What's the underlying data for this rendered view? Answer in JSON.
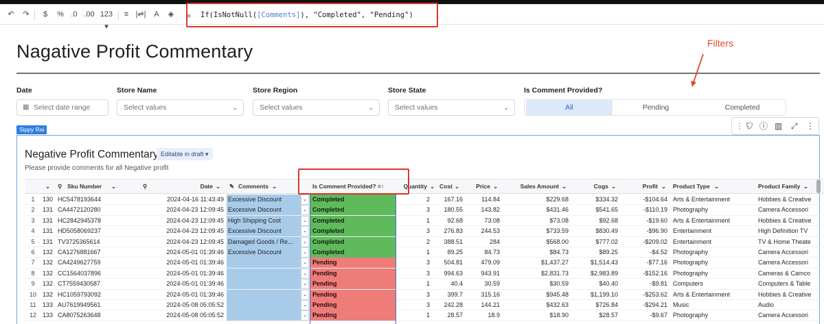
{
  "toolbar": {
    "buttons": [
      {
        "name": "undo-icon",
        "glyph": "↶"
      },
      {
        "name": "redo-icon",
        "glyph": "↷"
      },
      {
        "name": "currency-format-button",
        "glyph": "$"
      },
      {
        "name": "percent-format-button",
        "glyph": "%"
      },
      {
        "name": "decrease-decimals-button",
        "glyph": ".0"
      },
      {
        "name": "increase-decimals-button",
        "glyph": ".00"
      },
      {
        "name": "number-format-button",
        "glyph": "123 ▾"
      },
      {
        "name": "align-icon",
        "glyph": "≡"
      },
      {
        "name": "wrap-icon",
        "glyph": "|⇌|"
      },
      {
        "name": "text-color-icon",
        "glyph": "A"
      },
      {
        "name": "fill-color-icon",
        "glyph": "◈"
      }
    ],
    "formula_cancel": "×",
    "formula_prefix": "If(IsNotNull(",
    "formula_ref": "[Comments]",
    "formula_suffix": "), \"Completed\", \"Pending\")"
  },
  "page": {
    "title": "Nagative Profit Commentary",
    "annotation": "Filters"
  },
  "filters": {
    "date": {
      "label": "Date",
      "placeholder": "Select date range"
    },
    "store_name": {
      "label": "Store Name",
      "placeholder": "Select values"
    },
    "store_region": {
      "label": "Store Region",
      "placeholder": "Select values"
    },
    "store_state": {
      "label": "Store State",
      "placeholder": "Select values"
    },
    "is_comment": {
      "label": "Is Comment Provided?",
      "options": [
        "All",
        "Pending",
        "Completed"
      ],
      "selected": "All"
    }
  },
  "element": {
    "author_tag": "Sippy Rai",
    "title": "Negative Profit Commentary",
    "badge": "Editable in draft ▾",
    "subtitle": "Please provide comments for all Negative profit"
  },
  "table": {
    "columns": [
      "",
      "Sku Number",
      "",
      "Date",
      "Comments",
      "Is Comment Provided?",
      "Quantity",
      "Cost",
      "Price",
      "Sales Amount",
      "Cogs",
      "Profit",
      "Product Type",
      "Product Family"
    ],
    "rows": [
      {
        "n": "1",
        "id": "130",
        "sku": "HC5478193644",
        "date": "2024-04-16 11:43:49",
        "comment": "Excessive Discount",
        "status": "Completed",
        "qty": "2",
        "cost": "167.16",
        "price": "114.84",
        "sales": "$229.68",
        "cogs": "$334.32",
        "profit": "-$104.64",
        "ptype": "Arts & Entertainment",
        "pfamily": "Hobbies & Creative"
      },
      {
        "n": "2",
        "id": "131",
        "sku": "CA4472120280",
        "date": "2024-04-23 12:09:45",
        "comment": "Excessive Discount",
        "status": "Completed",
        "qty": "3",
        "cost": "180.55",
        "price": "143.82",
        "sales": "$431.46",
        "cogs": "$541.65",
        "profit": "-$110.19",
        "ptype": "Photography",
        "pfamily": "Camera Accessori"
      },
      {
        "n": "3",
        "id": "131",
        "sku": "HC2842945378",
        "date": "2024-04-23 12:09:45",
        "comment": "High Shipping Cost",
        "status": "Completed",
        "qty": "1",
        "cost": "92.68",
        "price": "73.08",
        "sales": "$73.08",
        "cogs": "$92.68",
        "profit": "-$19.60",
        "ptype": "Arts & Entertainment",
        "pfamily": "Hobbies & Creative"
      },
      {
        "n": "4",
        "id": "131",
        "sku": "HD5058069237",
        "date": "2024-04-23 12:09:45",
        "comment": "Excessive Discount",
        "status": "Completed",
        "qty": "3",
        "cost": "276.83",
        "price": "244.53",
        "sales": "$733.59",
        "cogs": "$830.49",
        "profit": "-$96.90",
        "ptype": "Entertainment",
        "pfamily": "High Definition TV"
      },
      {
        "n": "5",
        "id": "131",
        "sku": "TV3725365614",
        "date": "2024-04-23 12:09:45",
        "comment": "Damaged Goods / Re...",
        "status": "Completed",
        "qty": "2",
        "cost": "388.51",
        "price": "284",
        "sales": "$568.00",
        "cogs": "$777.02",
        "profit": "-$209.02",
        "ptype": "Entertainment",
        "pfamily": "TV & Home Theate"
      },
      {
        "n": "6",
        "id": "132",
        "sku": "CA1276881667",
        "date": "2024-05-01 01:39:46",
        "comment": "Excessive Discount",
        "status": "Completed",
        "qty": "1",
        "cost": "89.25",
        "price": "84.73",
        "sales": "$84.73",
        "cogs": "$89.25",
        "profit": "-$4.52",
        "ptype": "Photography",
        "pfamily": "Camera Accessori"
      },
      {
        "n": "7",
        "id": "132",
        "sku": "CA4249627759",
        "date": "2024-05-01 01:39:46",
        "comment": "",
        "status": "Pending",
        "qty": "3",
        "cost": "504.81",
        "price": "479.09",
        "sales": "$1,437.27",
        "cogs": "$1,514.43",
        "profit": "-$77.16",
        "ptype": "Photography",
        "pfamily": "Camera Accessori"
      },
      {
        "n": "8",
        "id": "132",
        "sku": "CC1564037896",
        "date": "2024-05-01 01:39:46",
        "comment": "",
        "status": "Pending",
        "qty": "3",
        "cost": "994.63",
        "price": "943.91",
        "sales": "$2,831.73",
        "cogs": "$2,983.89",
        "profit": "-$152.16",
        "ptype": "Photography",
        "pfamily": "Cameras & Camco"
      },
      {
        "n": "9",
        "id": "132",
        "sku": "CT7559430587",
        "date": "2024-05-01 01:39:46",
        "comment": "",
        "status": "Pending",
        "qty": "1",
        "cost": "40.4",
        "price": "30.59",
        "sales": "$30.59",
        "cogs": "$40.40",
        "profit": "-$9.81",
        "ptype": "Computers",
        "pfamily": "Computers & Table"
      },
      {
        "n": "10",
        "id": "132",
        "sku": "HC1059793092",
        "date": "2024-05-01 01:39:46",
        "comment": "",
        "status": "Pending",
        "qty": "3",
        "cost": "399.7",
        "price": "315.16",
        "sales": "$945.48",
        "cogs": "$1,199.10",
        "profit": "-$253.62",
        "ptype": "Arts & Entertainment",
        "pfamily": "Hobbies & Creative"
      },
      {
        "n": "11",
        "id": "133",
        "sku": "AU7619949561",
        "date": "2024-05-08 05:05:52",
        "comment": "",
        "status": "Pending",
        "qty": "3",
        "cost": "242.28",
        "price": "144.21",
        "sales": "$432.63",
        "cogs": "$726.84",
        "profit": "-$294.21",
        "ptype": "Music",
        "pfamily": "Audio"
      },
      {
        "n": "12",
        "id": "133",
        "sku": "CA8075263648",
        "date": "2024-05-08 05:05:52",
        "comment": "",
        "status": "Pending",
        "qty": "1",
        "cost": "28.57",
        "price": "18.9",
        "sales": "$18.90",
        "cogs": "$28.57",
        "profit": "-$9.67",
        "ptype": "Photography",
        "pfamily": "Camera Accessori"
      }
    ]
  },
  "colors": {
    "completed": "#5fba5c",
    "pending": "#ee7d7a",
    "comment_cell": "#a9cbea",
    "highlight": "#d9352b",
    "accent": "#2f7de0"
  }
}
